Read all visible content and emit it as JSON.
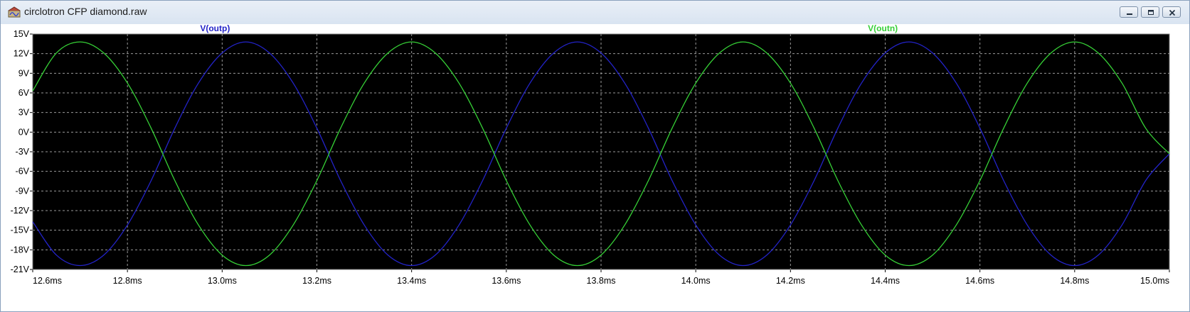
{
  "window": {
    "title": "circlotron CFP diamond.raw",
    "app_icon": "ltspice-waveform-icon",
    "controls": [
      "minimize-icon",
      "restore-icon",
      "close-icon"
    ]
  },
  "colors": {
    "plot_background": "#000000",
    "grid": "#9a9a9a",
    "series_outp": "#2323c8",
    "series_outn": "#36d036",
    "axis_text": "#000000"
  },
  "chart_data": {
    "type": "line",
    "grid": true,
    "x_unit": "ms",
    "y_unit": "V",
    "xlim": [
      12.6,
      15.0
    ],
    "ylim": [
      -21,
      15
    ],
    "x_ticks": [
      12.6,
      12.8,
      13.0,
      13.2,
      13.4,
      13.6,
      13.8,
      14.0,
      14.2,
      14.4,
      14.6,
      14.8,
      15.0
    ],
    "x_tick_labels": [
      "12.6ms",
      "12.8ms",
      "13.0ms",
      "13.2ms",
      "13.4ms",
      "13.6ms",
      "13.8ms",
      "14.0ms",
      "14.2ms",
      "14.4ms",
      "14.6ms",
      "14.8ms",
      "15.0ms"
    ],
    "y_ticks": [
      15,
      12,
      9,
      6,
      3,
      0,
      -3,
      -6,
      -9,
      -12,
      -15,
      -18,
      -21
    ],
    "y_tick_labels": [
      "15V",
      "12V",
      "9V",
      "6V",
      "3V",
      "0V",
      "-3V",
      "-6V",
      "-9V",
      "-12V",
      "-15V",
      "-18V",
      "-21V"
    ],
    "series": [
      {
        "name": "V(outp)",
        "color": "#2323c8",
        "x": [
          12.6,
          12.65,
          12.7,
          12.75,
          12.8,
          12.85,
          12.9,
          12.95,
          13.0,
          13.05,
          13.1,
          13.15,
          13.2,
          13.25,
          13.3,
          13.35,
          13.4,
          13.45,
          13.5,
          13.55,
          13.6,
          13.65,
          13.7,
          13.75,
          13.8,
          13.85,
          13.9,
          13.95,
          14.0,
          14.05,
          14.1,
          14.15,
          14.2,
          14.25,
          14.3,
          14.35,
          14.4,
          14.45,
          14.5,
          14.55,
          14.6,
          14.65,
          14.7,
          14.75,
          14.8,
          14.85,
          14.9,
          14.95,
          15.0
        ],
        "y": [
          -13.7,
          -18.8,
          -20.4,
          -18.8,
          -14.2,
          -7.4,
          0.6,
          7.5,
          12.1,
          13.8,
          12.1,
          7.5,
          0.6,
          -7.4,
          -14.2,
          -18.8,
          -20.4,
          -18.8,
          -14.2,
          -7.4,
          0.6,
          7.5,
          12.1,
          13.8,
          12.1,
          7.5,
          0.6,
          -7.4,
          -14.2,
          -18.8,
          -20.4,
          -18.8,
          -14.2,
          -7.4,
          0.6,
          7.5,
          12.1,
          13.8,
          12.1,
          7.5,
          0.6,
          -7.4,
          -14.2,
          -18.8,
          -20.4,
          -18.8,
          -14.2,
          -7.4,
          -3.3
        ]
      },
      {
        "name": "V(outn)",
        "color": "#36d036",
        "x": [
          12.6,
          12.65,
          12.7,
          12.75,
          12.8,
          12.85,
          12.9,
          12.95,
          13.0,
          13.05,
          13.1,
          13.15,
          13.2,
          13.25,
          13.3,
          13.35,
          13.4,
          13.45,
          13.5,
          13.55,
          13.6,
          13.65,
          13.7,
          13.75,
          13.8,
          13.85,
          13.9,
          13.95,
          14.0,
          14.05,
          14.1,
          14.15,
          14.2,
          14.25,
          14.3,
          14.35,
          14.4,
          14.45,
          14.5,
          14.55,
          14.6,
          14.65,
          14.7,
          14.75,
          14.8,
          14.85,
          14.9,
          14.95,
          15.0
        ],
        "y": [
          6.3,
          12.1,
          13.8,
          12.1,
          7.5,
          0.6,
          -7.4,
          -14.2,
          -18.8,
          -20.4,
          -18.8,
          -14.2,
          -7.4,
          0.6,
          7.5,
          12.1,
          13.8,
          12.1,
          7.5,
          0.6,
          -7.4,
          -14.2,
          -18.8,
          -20.4,
          -18.8,
          -14.2,
          -7.4,
          0.6,
          7.5,
          12.1,
          13.8,
          12.1,
          7.5,
          0.6,
          -7.4,
          -14.2,
          -18.8,
          -20.4,
          -18.8,
          -14.2,
          -7.4,
          0.6,
          7.5,
          12.1,
          13.8,
          12.1,
          7.5,
          0.6,
          -3.3
        ]
      }
    ]
  }
}
